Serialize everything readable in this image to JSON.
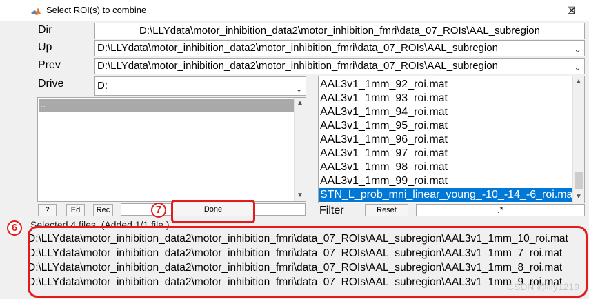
{
  "window": {
    "title": "Select ROI(s) to combine",
    "minimize": "—",
    "maximize": "☐",
    "close": "✕"
  },
  "labels": {
    "dir": "Dir",
    "up": "Up",
    "prev": "Prev",
    "drive": "Drive",
    "filter": "Filter"
  },
  "dir_value": "D:\\LLYdata\\motor_inhibition_data2\\motor_inhibition_fmri\\data_07_ROIs\\AAL_subregion",
  "up_value": "D:\\LLYdata\\motor_inhibition_data2\\motor_inhibition_fmri\\data_07_ROIs\\AAL_subregion",
  "prev_value": "D:\\LLYdata\\motor_inhibition_data2\\motor_inhibition_fmri\\data_07_ROIs\\AAL_subregion",
  "drive_value": "D:",
  "dir_list": {
    "selected": ".."
  },
  "file_list": [
    "AAL3v1_1mm_92_roi.mat",
    "AAL3v1_1mm_93_roi.mat",
    "AAL3v1_1mm_94_roi.mat",
    "AAL3v1_1mm_95_roi.mat",
    "AAL3v1_1mm_96_roi.mat",
    "AAL3v1_1mm_97_roi.mat",
    "AAL3v1_1mm_98_roi.mat",
    "AAL3v1_1mm_99_roi.mat",
    "STN_L_prob_mni_linear_young_-10_-14_-6_roi.mat"
  ],
  "selected_file_index": 8,
  "buttons": {
    "help": "?",
    "edit": "Ed",
    "rec": "Rec",
    "done": "Done",
    "reset": "Reset"
  },
  "filter_value": ".*",
  "status": "Selected 4 files. (Added 1/1 file.)",
  "results": [
    "D:\\LLYdata\\motor_inhibition_data2\\motor_inhibition_fmri\\data_07_ROIs\\AAL_subregion\\AAL3v1_1mm_10_roi.mat",
    "D:\\LLYdata\\motor_inhibition_data2\\motor_inhibition_fmri\\data_07_ROIs\\AAL_subregion\\AAL3v1_1mm_7_roi.mat",
    "D:\\LLYdata\\motor_inhibition_data2\\motor_inhibition_fmri\\data_07_ROIs\\AAL_subregion\\AAL3v1_1mm_8_roi.mat",
    "D:\\LLYdata\\motor_inhibition_data2\\motor_inhibition_fmri\\data_07_ROIs\\AAL_subregion\\AAL3v1_1mm_9_roi.mat"
  ],
  "annotations": {
    "badge_done": "7",
    "badge_results": "6",
    "color": "#e31b1b"
  },
  "watermark": "CSDN @lily1219",
  "colors": {
    "selection": "#0078d7",
    "dir_selection": "#a9a9a9"
  }
}
